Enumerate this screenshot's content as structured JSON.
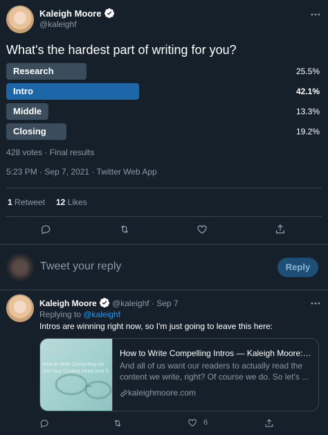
{
  "tweet": {
    "author_name": "Kaleigh Moore",
    "handle": "@kaleighf",
    "question": "What's the hardest part of writing for you?",
    "poll": [
      {
        "label": "Research",
        "percent_text": "25.5%",
        "percent": 25.5,
        "winner": false
      },
      {
        "label": "Intro",
        "percent_text": "42.1%",
        "percent": 42.1,
        "winner": true
      },
      {
        "label": "Middle",
        "percent_text": "13.3%",
        "percent": 13.3,
        "winner": false
      },
      {
        "label": "Closing",
        "percent_text": "19.2%",
        "percent": 19.2,
        "winner": false
      }
    ],
    "poll_meta": "428 votes · Final results",
    "timestamp": "5:23 PM · Sep 7, 2021 · Twitter Web App",
    "retweet_count": "1",
    "retweet_label": "Retweet",
    "likes_count": "12",
    "likes_label": "Likes"
  },
  "compose": {
    "placeholder": "Tweet your reply",
    "reply_button": "Reply"
  },
  "reply": {
    "author_name": "Kaleigh Moore",
    "handle": "@kaleighf",
    "date": "· Sep 7",
    "replying_to_prefix": "Replying to ",
    "replying_to_handle": "@kaleighf",
    "text": "Intros are winning right now, so I'm just going to leave this here:",
    "card": {
      "image_text_1": "How to Write Compelling Intr",
      "image_text_2": "Get Your Content Read (and S",
      "title": "How to Write Compelling Intros — Kaleigh Moore: ...",
      "description": "And all of us want our readers to actually read the content we write, right? Of course we do. So let's ...",
      "link": "kaleighmoore.com"
    },
    "like_count": "6"
  },
  "colors": {
    "background": "#15202b",
    "winner_bar": "#1d67a8",
    "bar": "#3b4c5c",
    "accent": "#1d9bf0",
    "muted": "#8b98a5"
  },
  "icons": [
    "more-icon",
    "verified-icon",
    "reply-icon",
    "retweet-icon",
    "like-icon",
    "share-icon",
    "link-icon"
  ]
}
